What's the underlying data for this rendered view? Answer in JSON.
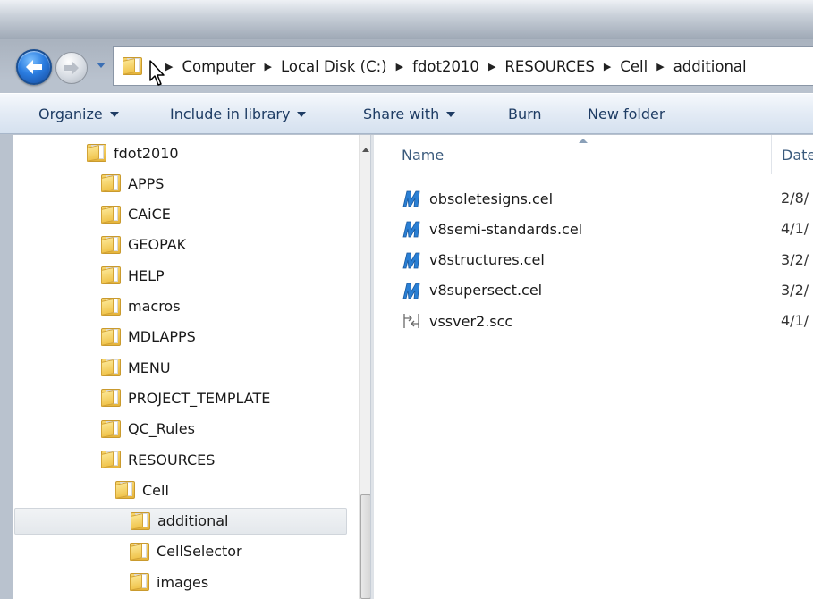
{
  "breadcrumbs": [
    "Computer",
    "Local Disk (C:)",
    "fdot2010",
    "RESOURCES",
    "Cell",
    "additional"
  ],
  "toolbar": {
    "organize": "Organize",
    "include_in_library": "Include in library",
    "share_with": "Share with",
    "burn": "Burn",
    "new_folder": "New folder"
  },
  "tree": [
    {
      "label": "fdot2010",
      "indent": 0,
      "selected": false
    },
    {
      "label": "APPS",
      "indent": 1,
      "selected": false
    },
    {
      "label": "CAiCE",
      "indent": 1,
      "selected": false
    },
    {
      "label": "GEOPAK",
      "indent": 1,
      "selected": false
    },
    {
      "label": "HELP",
      "indent": 1,
      "selected": false
    },
    {
      "label": "macros",
      "indent": 1,
      "selected": false
    },
    {
      "label": "MDLAPPS",
      "indent": 1,
      "selected": false
    },
    {
      "label": "MENU",
      "indent": 1,
      "selected": false
    },
    {
      "label": "PROJECT_TEMPLATE",
      "indent": 1,
      "selected": false
    },
    {
      "label": "QC_Rules",
      "indent": 1,
      "selected": false
    },
    {
      "label": "RESOURCES",
      "indent": 1,
      "selected": false
    },
    {
      "label": "Cell",
      "indent": 2,
      "selected": false
    },
    {
      "label": "additional",
      "indent": 3,
      "selected": true
    },
    {
      "label": "CellSelector",
      "indent": 3,
      "selected": false
    },
    {
      "label": "images",
      "indent": 3,
      "selected": false
    }
  ],
  "columns": {
    "name": "Name",
    "date": "Date"
  },
  "files": [
    {
      "name": "obsoletesigns.cel",
      "date": "2/8/",
      "icon": "microstation-icon"
    },
    {
      "name": "v8semi-standards.cel",
      "date": "4/1/",
      "icon": "microstation-icon"
    },
    {
      "name": "v8structures.cel",
      "date": "3/2/",
      "icon": "microstation-icon"
    },
    {
      "name": "v8supersect.cel",
      "date": "3/2/",
      "icon": "microstation-icon"
    },
    {
      "name": "vssver2.scc",
      "date": "4/1/",
      "icon": "scc-file-icon"
    }
  ],
  "colors": {
    "accent": "#1e3c64",
    "selection": "#e4e8ec",
    "back_button": "#2b7de0"
  }
}
